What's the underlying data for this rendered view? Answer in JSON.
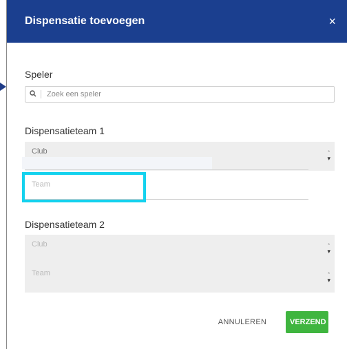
{
  "modal": {
    "title": "Dispensatie toevoegen",
    "close_symbol": "×"
  },
  "player": {
    "label": "Speler",
    "search_placeholder": "Zoek een speler",
    "search_icon_glyph": "🔍"
  },
  "team1": {
    "label": "Dispensatieteam 1",
    "club_placeholder": "Club",
    "team_placeholder": "Team",
    "required_marker": "*"
  },
  "team2": {
    "label": "Dispensatieteam 2",
    "club_placeholder": "Club",
    "team_placeholder": "Team",
    "required_marker": "*"
  },
  "actions": {
    "cancel_label": "ANNULEREN",
    "submit_label": "VERZEND"
  },
  "colors": {
    "header_bg": "#1b3f8f",
    "submit_bg": "#3fb53f",
    "highlight": "#14d2ee"
  }
}
